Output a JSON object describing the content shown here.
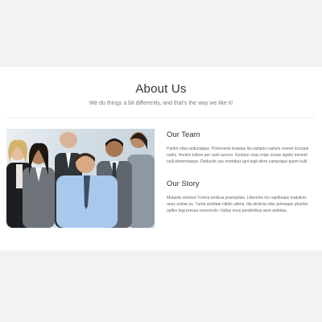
{
  "about": {
    "title": "About Us",
    "subtitle": "We do things a bit differently, and that's the way we like it!"
  },
  "team_photo": {
    "alt": "team-photo"
  },
  "sections": [
    {
      "heading": "Our Team",
      "text": "Partim orba seductaque. Porrexerat mutatas ita campos caelum viseret locoque nudis. Homini tollere aer caeli acervo. Godduo onus origo zonae lapeto inminet nulli elementaque. Deducite usu montibus igni tegit diere campoque quem nulli."
    },
    {
      "heading": "Our Story",
      "text": "Mutastis semine! Forma tonitrua praecipites. Liberioris nix rapidisque matutinis unus undae os. Turba ambitae nitidis ultima. Illa declivia orbe primaque phoebe opifex tegi pressa crescendo. Vultus onus ponderibus aere ambitas."
    }
  ],
  "colors": {
    "page_background": "#f2f2f2",
    "section_background": "#ffffff",
    "heading": "#333333",
    "body_text": "#666666"
  }
}
